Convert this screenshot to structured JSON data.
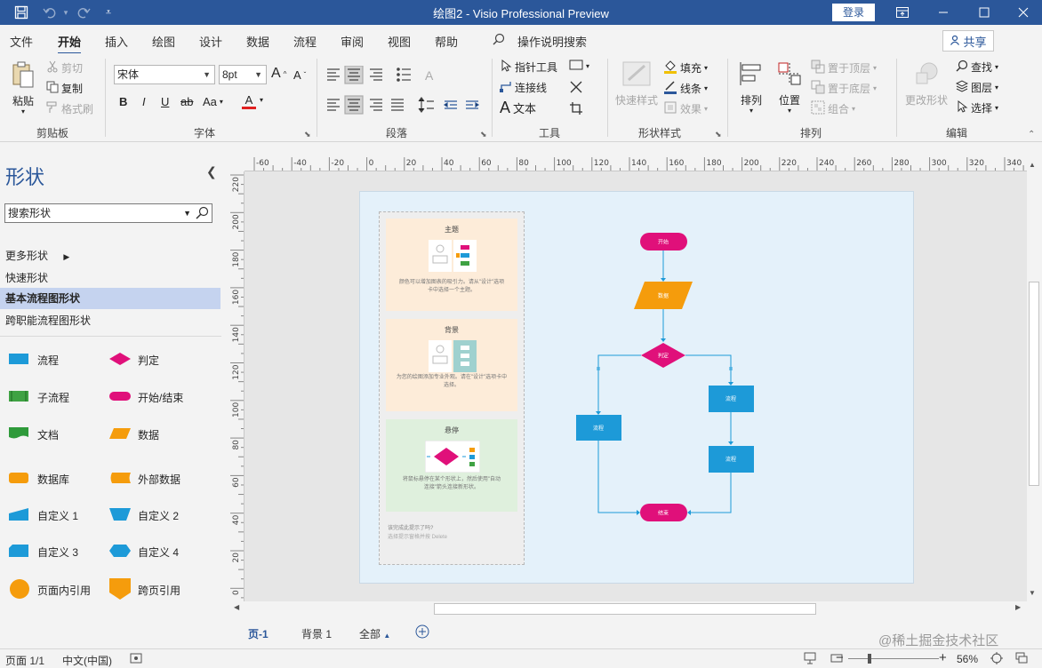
{
  "app": {
    "window_title": "绘图2  -  Visio Professional Preview",
    "login_label": "登录",
    "share_label": "共享"
  },
  "menu": {
    "tabs": [
      "文件",
      "开始",
      "插入",
      "绘图",
      "设计",
      "数据",
      "流程",
      "审阅",
      "视图",
      "帮助"
    ],
    "active": "开始",
    "tell_me": "操作说明搜索"
  },
  "ribbon": {
    "clipboard": {
      "paste": "粘贴",
      "cut": "剪切",
      "copy": "复制",
      "format_painter": "格式刷",
      "label": "剪贴板"
    },
    "font": {
      "family": "宋体",
      "size": "8pt",
      "grow": "A",
      "shrink": "A",
      "bold": "B",
      "italic": "I",
      "underline": "U",
      "strike": "ab",
      "case": "Aa",
      "color": "A",
      "label": "字体"
    },
    "paragraph": {
      "label": "段落"
    },
    "tools": {
      "pointer": "指针工具",
      "connector": "连接线",
      "text": "文本",
      "label": "工具"
    },
    "shape_styles": {
      "quick_styles": "快速样式",
      "fill": "填充",
      "line": "线条",
      "effects": "效果",
      "label": "形状样式"
    },
    "arrange": {
      "align": "排列",
      "position": "位置",
      "bring_front": "置于顶层",
      "send_back": "置于底层",
      "group": "组合",
      "label": "排列"
    },
    "editing": {
      "change_shape": "更改形状",
      "find": "查找",
      "layers": "图层",
      "select": "选择",
      "label": "编辑"
    }
  },
  "shapes_pane": {
    "title": "形状",
    "search_placeholder": "搜索形状",
    "links": [
      "更多形状",
      "快速形状",
      "基本流程图形状",
      "跨职能流程图形状"
    ],
    "selected_link": "基本流程图形状",
    "stencils": [
      {
        "name": "流程",
        "icon": "process-shape-icon"
      },
      {
        "name": "判定",
        "icon": "decision-shape-icon"
      },
      {
        "name": "子流程",
        "icon": "subprocess-shape-icon"
      },
      {
        "name": "开始/结束",
        "icon": "start-end-shape-icon"
      },
      {
        "name": "文档",
        "icon": "document-shape-icon"
      },
      {
        "name": "数据",
        "icon": "data-shape-icon"
      },
      {
        "name": "数据库",
        "icon": "database-shape-icon"
      },
      {
        "name": "外部数据",
        "icon": "external-data-shape-icon"
      },
      {
        "name": "自定义 1",
        "icon": "custom1-shape-icon"
      },
      {
        "name": "自定义 2",
        "icon": "custom2-shape-icon"
      },
      {
        "name": "自定义 3",
        "icon": "custom3-shape-icon"
      },
      {
        "name": "自定义 4",
        "icon": "custom4-shape-icon"
      },
      {
        "name": "页面内引用",
        "icon": "on-page-reference-icon"
      },
      {
        "name": "跨页引用",
        "icon": "off-page-reference-icon"
      }
    ]
  },
  "rulers": {
    "h_ticks": [
      "-60",
      "-40",
      "-20",
      "0",
      "20",
      "40",
      "60",
      "80",
      "100",
      "120",
      "140",
      "160",
      "180",
      "200",
      "220",
      "240",
      "260",
      "280",
      "300",
      "320",
      "340"
    ],
    "v_ticks": [
      "220",
      "200",
      "180",
      "160",
      "140",
      "120",
      "100",
      "80",
      "60",
      "40",
      "20",
      "0"
    ]
  },
  "tips": {
    "cards": [
      {
        "title": "主题",
        "text1": "颜色可以增加图表的吸引力。请从\"设计\"选项",
        "text2": "卡中选择一个主题。"
      },
      {
        "title": "背景",
        "text1": "为您的绘图添加专业外观。请在\"设计\"选项卡中",
        "text2": "选择。"
      },
      {
        "title": "悬停",
        "text1": "将鼠标悬停在某个形状上，然后使用\"自动",
        "text2": "连接\"箭头连接新形状。"
      }
    ],
    "footer1": "该完成此提示了吗?",
    "footer2": "选择提示窗格并按 Delete"
  },
  "flowchart": {
    "start": "开始",
    "data": "数据",
    "decision": "判定",
    "process_left": "流程",
    "process_right1": "流程",
    "process_right2": "流程",
    "end": "结束",
    "colors": {
      "terminator": "#e0107a",
      "data": "#f59c0c",
      "process": "#1d9ad8",
      "connector": "#1d9ad8"
    }
  },
  "page_tabs": {
    "tabs": [
      "页-1",
      "背景 1",
      "全部"
    ],
    "active": "页-1"
  },
  "status_bar": {
    "page": "页面 1/1",
    "language": "中文(中国)",
    "zoom": "56%"
  },
  "watermark": "@稀土掘金技术社区"
}
